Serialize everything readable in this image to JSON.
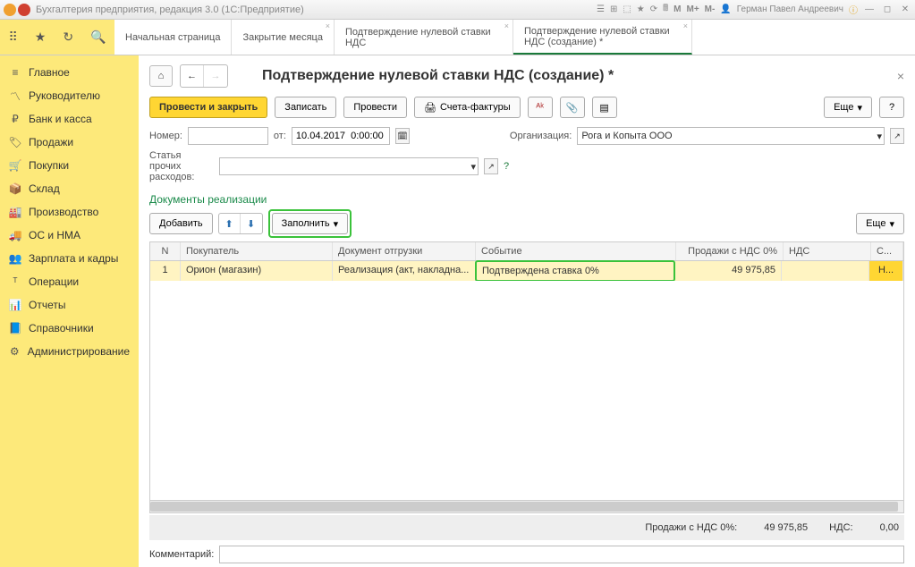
{
  "title": "Бухгалтерия предприятия, редакция 3.0  (1С:Предприятие)",
  "user": "Герман Павел Андреевич",
  "m_labels": [
    "M",
    "M+",
    "M-"
  ],
  "tabs": [
    {
      "label": "Начальная страница"
    },
    {
      "label": "Закрытие месяца"
    },
    {
      "label": "Подтверждение нулевой ставки НДС"
    },
    {
      "label": "Подтверждение нулевой ставки НДС (создание) *"
    }
  ],
  "sidebar": [
    {
      "label": "Главное"
    },
    {
      "label": "Руководителю"
    },
    {
      "label": "Банк и касса"
    },
    {
      "label": "Продажи"
    },
    {
      "label": "Покупки"
    },
    {
      "label": "Склад"
    },
    {
      "label": "Производство"
    },
    {
      "label": "ОС и НМА"
    },
    {
      "label": "Зарплата и кадры"
    },
    {
      "label": "Операции"
    },
    {
      "label": "Отчеты"
    },
    {
      "label": "Справочники"
    },
    {
      "label": "Администрирование"
    }
  ],
  "page_title": "Подтверждение нулевой ставки НДС (создание) *",
  "toolbar": {
    "post_close": "Провести и закрыть",
    "save": "Записать",
    "post": "Провести",
    "invoices": "Счета-фактуры",
    "more": "Еще"
  },
  "labels": {
    "number": "Номер:",
    "from": "от:",
    "org": "Организация:",
    "expense_item": "Статья прочих расходов:",
    "section": "Документы реализации",
    "add": "Добавить",
    "fill": "Заполнить",
    "comment": "Комментарий:",
    "totals_sales": "Продажи с НДС 0%:",
    "totals_nds": "НДС:"
  },
  "form": {
    "date": "10.04.2017  0:00:00",
    "org": "Рога и Копыта ООО"
  },
  "columns": {
    "n": "N",
    "buyer": "Покупатель",
    "doc": "Документ отгрузки",
    "event": "Событие",
    "sales": "Продажи с НДС 0%",
    "nds": "НДС",
    "last": "С..."
  },
  "row": {
    "n": "1",
    "buyer": "Орион (магазин)",
    "doc": "Реализация (акт, накладна...",
    "event": "Подтверждена ставка 0%",
    "sales": "49 975,85",
    "last": "Н..."
  },
  "totals": {
    "sales": "49 975,85",
    "nds": "0,00"
  }
}
